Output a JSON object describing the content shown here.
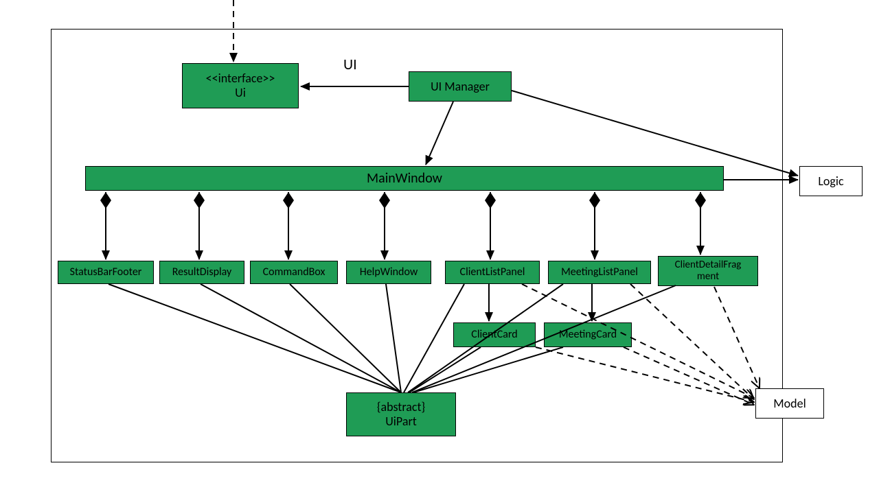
{
  "package_label": "UI",
  "nodes": {
    "ui_interface": {
      "line1": "<<interface>>",
      "line2": "Ui"
    },
    "ui_manager": "UI Manager",
    "main_window": "MainWindow",
    "status_bar_footer": "StatusBarFooter",
    "result_display": "ResultDisplay",
    "command_box": "CommandBox",
    "help_window": "HelpWindow",
    "client_list_panel": "ClientListPanel",
    "meeting_list_panel": "MeetingListPanel",
    "client_detail_fragment": {
      "line1": "ClientDetailFrag",
      "line2": "ment"
    },
    "client_card": "ClientCard",
    "meeting_card": "MeetingCard",
    "ui_part": {
      "line1": "{abstract}",
      "line2": "UiPart"
    },
    "logic": "Logic",
    "model": "Model"
  },
  "chart_data": {
    "type": "uml_class_diagram",
    "title": "UI",
    "classes": [
      {
        "name": "Ui",
        "stereotype": "interface"
      },
      {
        "name": "UI Manager"
      },
      {
        "name": "MainWindow"
      },
      {
        "name": "StatusBarFooter"
      },
      {
        "name": "ResultDisplay"
      },
      {
        "name": "CommandBox"
      },
      {
        "name": "HelpWindow"
      },
      {
        "name": "ClientListPanel"
      },
      {
        "name": "MeetingListPanel"
      },
      {
        "name": "ClientDetailFragment"
      },
      {
        "name": "ClientCard"
      },
      {
        "name": "MeetingCard"
      },
      {
        "name": "UiPart",
        "stereotype": "abstract"
      }
    ],
    "external_classes": [
      "Logic",
      "Model"
    ],
    "relationships": [
      {
        "from": "UI Manager",
        "to": "Ui",
        "type": "realization_or_assoc",
        "arrow": "solid-open"
      },
      {
        "from": "UI Manager",
        "to": "MainWindow",
        "type": "association",
        "arrow": "solid-open"
      },
      {
        "from": "UI Manager",
        "to": "Logic",
        "type": "association",
        "arrow": "solid-open"
      },
      {
        "from": "MainWindow",
        "to": "Logic",
        "type": "association",
        "arrow": "solid-open"
      },
      {
        "from": "MainWindow",
        "to": "StatusBarFooter",
        "type": "composition"
      },
      {
        "from": "MainWindow",
        "to": "ResultDisplay",
        "type": "composition"
      },
      {
        "from": "MainWindow",
        "to": "CommandBox",
        "type": "composition"
      },
      {
        "from": "MainWindow",
        "to": "HelpWindow",
        "type": "composition"
      },
      {
        "from": "MainWindow",
        "to": "ClientListPanel",
        "type": "composition"
      },
      {
        "from": "MainWindow",
        "to": "MeetingListPanel",
        "type": "composition"
      },
      {
        "from": "MainWindow",
        "to": "ClientDetailFragment",
        "type": "composition"
      },
      {
        "from": "ClientListPanel",
        "to": "ClientCard",
        "type": "association",
        "arrow": "solid-open"
      },
      {
        "from": "MeetingListPanel",
        "to": "MeetingCard",
        "type": "association",
        "arrow": "solid-open"
      },
      {
        "from": "StatusBarFooter",
        "to": "UiPart",
        "type": "generalization",
        "arrow": "solid"
      },
      {
        "from": "ResultDisplay",
        "to": "UiPart",
        "type": "generalization",
        "arrow": "solid"
      },
      {
        "from": "CommandBox",
        "to": "UiPart",
        "type": "generalization",
        "arrow": "solid"
      },
      {
        "from": "HelpWindow",
        "to": "UiPart",
        "type": "generalization",
        "arrow": "solid"
      },
      {
        "from": "ClientListPanel",
        "to": "UiPart",
        "type": "generalization",
        "arrow": "solid"
      },
      {
        "from": "MeetingListPanel",
        "to": "UiPart",
        "type": "generalization",
        "arrow": "solid"
      },
      {
        "from": "ClientDetailFragment",
        "to": "UiPart",
        "type": "generalization",
        "arrow": "solid"
      },
      {
        "from": "ClientCard",
        "to": "UiPart",
        "type": "generalization",
        "arrow": "solid"
      },
      {
        "from": "MeetingCard",
        "to": "UiPart",
        "type": "generalization",
        "arrow": "solid"
      },
      {
        "from": "ClientListPanel",
        "to": "Model",
        "type": "dependency",
        "arrow": "dashed-open"
      },
      {
        "from": "MeetingListPanel",
        "to": "Model",
        "type": "dependency",
        "arrow": "dashed-open"
      },
      {
        "from": "ClientDetailFragment",
        "to": "Model",
        "type": "dependency",
        "arrow": "dashed-open"
      },
      {
        "from": "ClientCard",
        "to": "Model",
        "type": "dependency",
        "arrow": "dashed-open"
      },
      {
        "from": "MeetingCard",
        "to": "Model",
        "type": "dependency",
        "arrow": "dashed-open"
      }
    ]
  }
}
